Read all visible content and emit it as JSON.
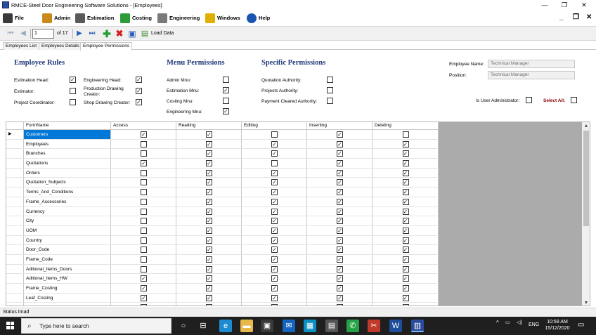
{
  "window": {
    "title": "RMCE-Steel Door Engineering Software Solutions - [Employees]",
    "minimize": "—",
    "restore": "❐",
    "close": "✕"
  },
  "menu": {
    "items": [
      {
        "label": "File",
        "icon": "book-icon",
        "color": "#3a3a3a"
      },
      {
        "label": "Admin",
        "icon": "pencil-icon",
        "color": "#c88a1a"
      },
      {
        "label": "Estimation",
        "icon": "calculator-icon",
        "color": "#5a5a5a"
      },
      {
        "label": "Costing",
        "icon": "money-icon",
        "color": "#2e9b3a"
      },
      {
        "label": "Engineering",
        "icon": "gear-icon",
        "color": "#7a7a7a"
      },
      {
        "label": "Windows",
        "icon": "windows-icon",
        "color": "#e0b000"
      },
      {
        "label": "Help",
        "icon": "help-icon",
        "color": "#1a56b0"
      }
    ],
    "mdi_minimize": "_",
    "mdi_restore": "❐",
    "mdi_close": "✕"
  },
  "navigator": {
    "position": "1",
    "count": "of 17",
    "load_label": "Load Data"
  },
  "tabs": [
    {
      "label": "Employees List"
    },
    {
      "label": "Employees Details"
    },
    {
      "label": "Employee Permissions",
      "active": true
    }
  ],
  "employee_rules": {
    "title": "Employee Rules",
    "items": [
      {
        "label": "Estimation Head:",
        "checked": true
      },
      {
        "label": "Estimator:",
        "checked": false
      },
      {
        "label": "Project Coordinator:",
        "checked": false
      },
      {
        "label": "Engineering Head:",
        "checked": true
      },
      {
        "label": "Production Drawing",
        "label2": "Creator:",
        "checked": true
      },
      {
        "label": "Shop Drawing Creator:",
        "checked": true
      }
    ]
  },
  "menu_permissions": {
    "title": "Menu Permissions",
    "items": [
      {
        "label": "Admin Mnu:",
        "checked": false
      },
      {
        "label": "Estimation Mnu:",
        "checked": true
      },
      {
        "label": "Costing Mnu:",
        "checked": false
      },
      {
        "label": "Engineering Mnu:",
        "checked": true
      }
    ]
  },
  "specific_permissions": {
    "title": "Specific Permissions",
    "items": [
      {
        "label": "Quotation Authority:",
        "checked": false
      },
      {
        "label": "Projects Authority:",
        "checked": false
      },
      {
        "label": "Payment Cleared Authority:",
        "checked": false
      }
    ]
  },
  "employee": {
    "name_label": "Employee Name:",
    "name_value": "Technical Manager",
    "position_label": "Position:",
    "position_value": "Technical Manager",
    "is_admin_label": "Is User Administrator:",
    "is_admin_checked": false,
    "select_all_label": "Select All:",
    "select_all_checked": false
  },
  "grid": {
    "columns": [
      "FormName",
      "Access",
      "Reading",
      "Editing",
      "Inserting",
      "Deleting"
    ],
    "current_row_marker": "▶",
    "rows": [
      {
        "name": "Customers",
        "access": true,
        "reading": true,
        "editing": false,
        "inserting": true,
        "deleting": false,
        "selected": true
      },
      {
        "name": "Employees",
        "access": false,
        "reading": true,
        "editing": true,
        "inserting": true,
        "deleting": true
      },
      {
        "name": "Branches",
        "access": false,
        "reading": true,
        "editing": true,
        "inserting": true,
        "deleting": true
      },
      {
        "name": "Quotations",
        "access": true,
        "reading": true,
        "editing": false,
        "inserting": true,
        "deleting": true
      },
      {
        "name": "Orders",
        "access": false,
        "reading": true,
        "editing": true,
        "inserting": true,
        "deleting": true
      },
      {
        "name": "Quotation_Subjects",
        "access": false,
        "reading": true,
        "editing": true,
        "inserting": true,
        "deleting": true
      },
      {
        "name": "Terms_And_Conditions",
        "access": false,
        "reading": true,
        "editing": true,
        "inserting": true,
        "deleting": true
      },
      {
        "name": "Frame_Accessories",
        "access": false,
        "reading": true,
        "editing": true,
        "inserting": true,
        "deleting": true
      },
      {
        "name": "Currency",
        "access": false,
        "reading": true,
        "editing": true,
        "inserting": true,
        "deleting": true
      },
      {
        "name": "City",
        "access": false,
        "reading": true,
        "editing": true,
        "inserting": true,
        "deleting": true
      },
      {
        "name": "UOM",
        "access": false,
        "reading": true,
        "editing": true,
        "inserting": true,
        "deleting": true
      },
      {
        "name": "Country",
        "access": false,
        "reading": true,
        "editing": true,
        "inserting": true,
        "deleting": true
      },
      {
        "name": "Door_Code",
        "access": false,
        "reading": true,
        "editing": true,
        "inserting": true,
        "deleting": true
      },
      {
        "name": "Frame_Code",
        "access": false,
        "reading": true,
        "editing": true,
        "inserting": true,
        "deleting": true
      },
      {
        "name": "Aditional_Items_Doors",
        "access": false,
        "reading": true,
        "editing": true,
        "inserting": true,
        "deleting": true
      },
      {
        "name": "Aditional_Items_HW",
        "access": true,
        "reading": true,
        "editing": true,
        "inserting": true,
        "deleting": true
      },
      {
        "name": "Frame_Costing",
        "access": true,
        "reading": true,
        "editing": true,
        "inserting": true,
        "deleting": true
      },
      {
        "name": "Leaf_Costing",
        "access": true,
        "reading": true,
        "editing": true,
        "inserting": true,
        "deleting": true
      },
      {
        "name": "",
        "access": true,
        "reading": true,
        "editing": true,
        "inserting": true,
        "deleting": true
      }
    ]
  },
  "status": {
    "text": "Status  Imad"
  },
  "taskbar": {
    "search_placeholder": "Type here to search",
    "tray_text": "ENG",
    "time": "10:58 AM",
    "date": "15/12/2020",
    "apps": [
      {
        "icon": "cortana-icon",
        "color": "#1f1f1f",
        "glyph": "○"
      },
      {
        "icon": "task-view-icon",
        "color": "#1f1f1f",
        "glyph": "⊟"
      },
      {
        "icon": "edge-icon",
        "color": "#1d8bd1",
        "glyph": "e"
      },
      {
        "icon": "folder-icon",
        "color": "#e8b84a",
        "glyph": "▬"
      },
      {
        "icon": "store-icon",
        "color": "#3a3a3a",
        "glyph": "▣"
      },
      {
        "icon": "mail-icon",
        "color": "#1565c0",
        "glyph": "✉"
      },
      {
        "icon": "photos-icon",
        "color": "#0a8fc4",
        "glyph": "▦"
      },
      {
        "icon": "calculator-app-icon",
        "color": "#555555",
        "glyph": "▤"
      },
      {
        "icon": "whatsapp-icon",
        "color": "#25a244",
        "glyph": "✆"
      },
      {
        "icon": "snip-icon",
        "color": "#c0392b",
        "glyph": "✂"
      },
      {
        "icon": "word-icon",
        "color": "#1e4f9c",
        "glyph": "W"
      },
      {
        "icon": "rmce-app-icon",
        "color": "#2b4c9a",
        "glyph": "▥"
      }
    ]
  }
}
